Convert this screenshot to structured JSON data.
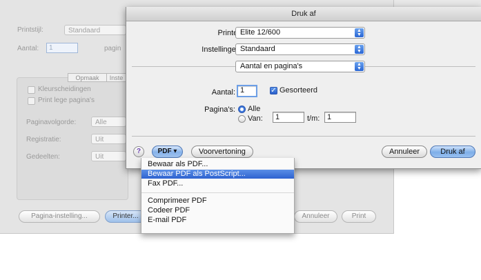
{
  "background_dialog": {
    "printer_style_label": "Printstijl:",
    "printer_style_value": "Standaard",
    "copies_label": "Aantal:",
    "copies_value": "1",
    "pages_partial": "pagin",
    "tabs": [
      "Opmaak",
      "Inste"
    ],
    "checkbox_color_separations": "Kleurscheidingen",
    "checkbox_blank_pages": "Print lege pagina's",
    "page_order_label": "Paginavolgorde:",
    "page_order_value": "Alle",
    "registration_label": "Registratie:",
    "registration_value": "Uit",
    "parts_label": "Gedeelten:",
    "parts_value": "Uit",
    "page_setup_button": "Pagina-instelling...",
    "printer_button": "Printer...",
    "cancel_button": "Annuleer",
    "print_button": "Print"
  },
  "print_sheet": {
    "title": "Druk af",
    "printer_label": "Printer:",
    "printer_value": "Elite 12/600",
    "presets_label": "Instellingen:",
    "presets_value": "Standaard",
    "section_value": "Aantal en pagina's",
    "copies_label": "Aantal:",
    "copies_value": "1",
    "collated_label": "Gesorteerd",
    "pages_label": "Pagina's:",
    "all_label": "Alle",
    "from_label": "Van:",
    "from_value": "1",
    "to_label": "t/m:",
    "to_value": "1",
    "help_glyph": "?",
    "pdf_button": "PDF ▾",
    "preview_button": "Voorvertoning",
    "cancel_button": "Annuleer",
    "print_button": "Druk af"
  },
  "pdf_menu": {
    "items": [
      "Bewaar als PDF...",
      "Bewaar PDF als PostScript...",
      "Fax PDF...",
      "Comprimeer PDF",
      "Codeer PDF",
      "E-mail PDF"
    ],
    "selected_index": 1
  }
}
